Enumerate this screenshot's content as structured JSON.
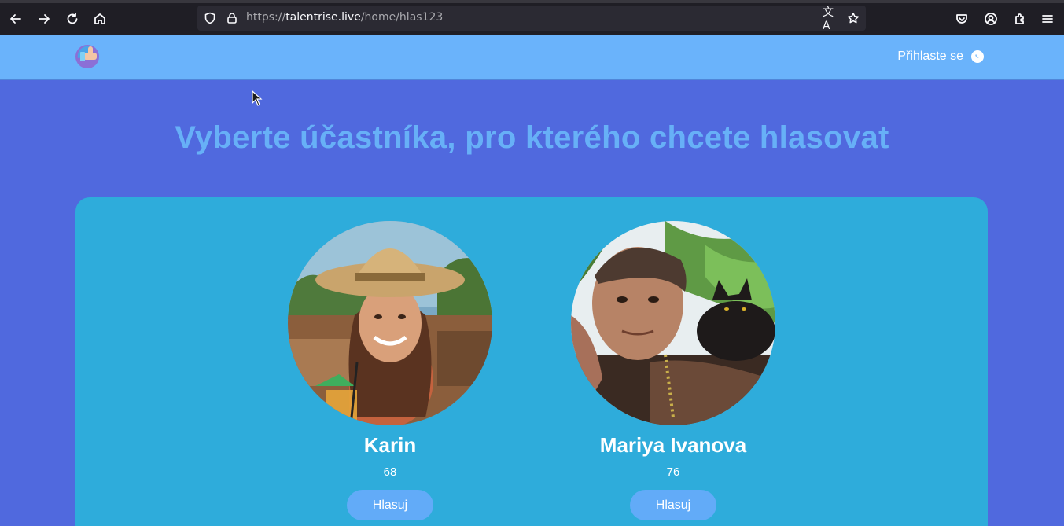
{
  "browser": {
    "url_scheme": "https://",
    "url_host": "talentrise.live",
    "url_path": "/home/hlas123",
    "translate_glyph": "文A"
  },
  "header": {
    "login_label": "Přihlaste se",
    "login_icon": "whatsapp-icon",
    "logo_icon": "thumbs-up-logo"
  },
  "main": {
    "headline": "Vyberte účastníka, pro kterého chcete hlasovat",
    "contestants": [
      {
        "name": "Karin",
        "votes": "68",
        "vote_label": "Hlasuj"
      },
      {
        "name": "Mariya Ivanova",
        "votes": "76",
        "vote_label": "Hlasuj"
      }
    ]
  },
  "colors": {
    "page_background": "#5069de",
    "header_background": "#6ab3fb",
    "panel_background": "#2eacdb",
    "headline": "#67b0f7",
    "vote_button": "#62abf8"
  }
}
